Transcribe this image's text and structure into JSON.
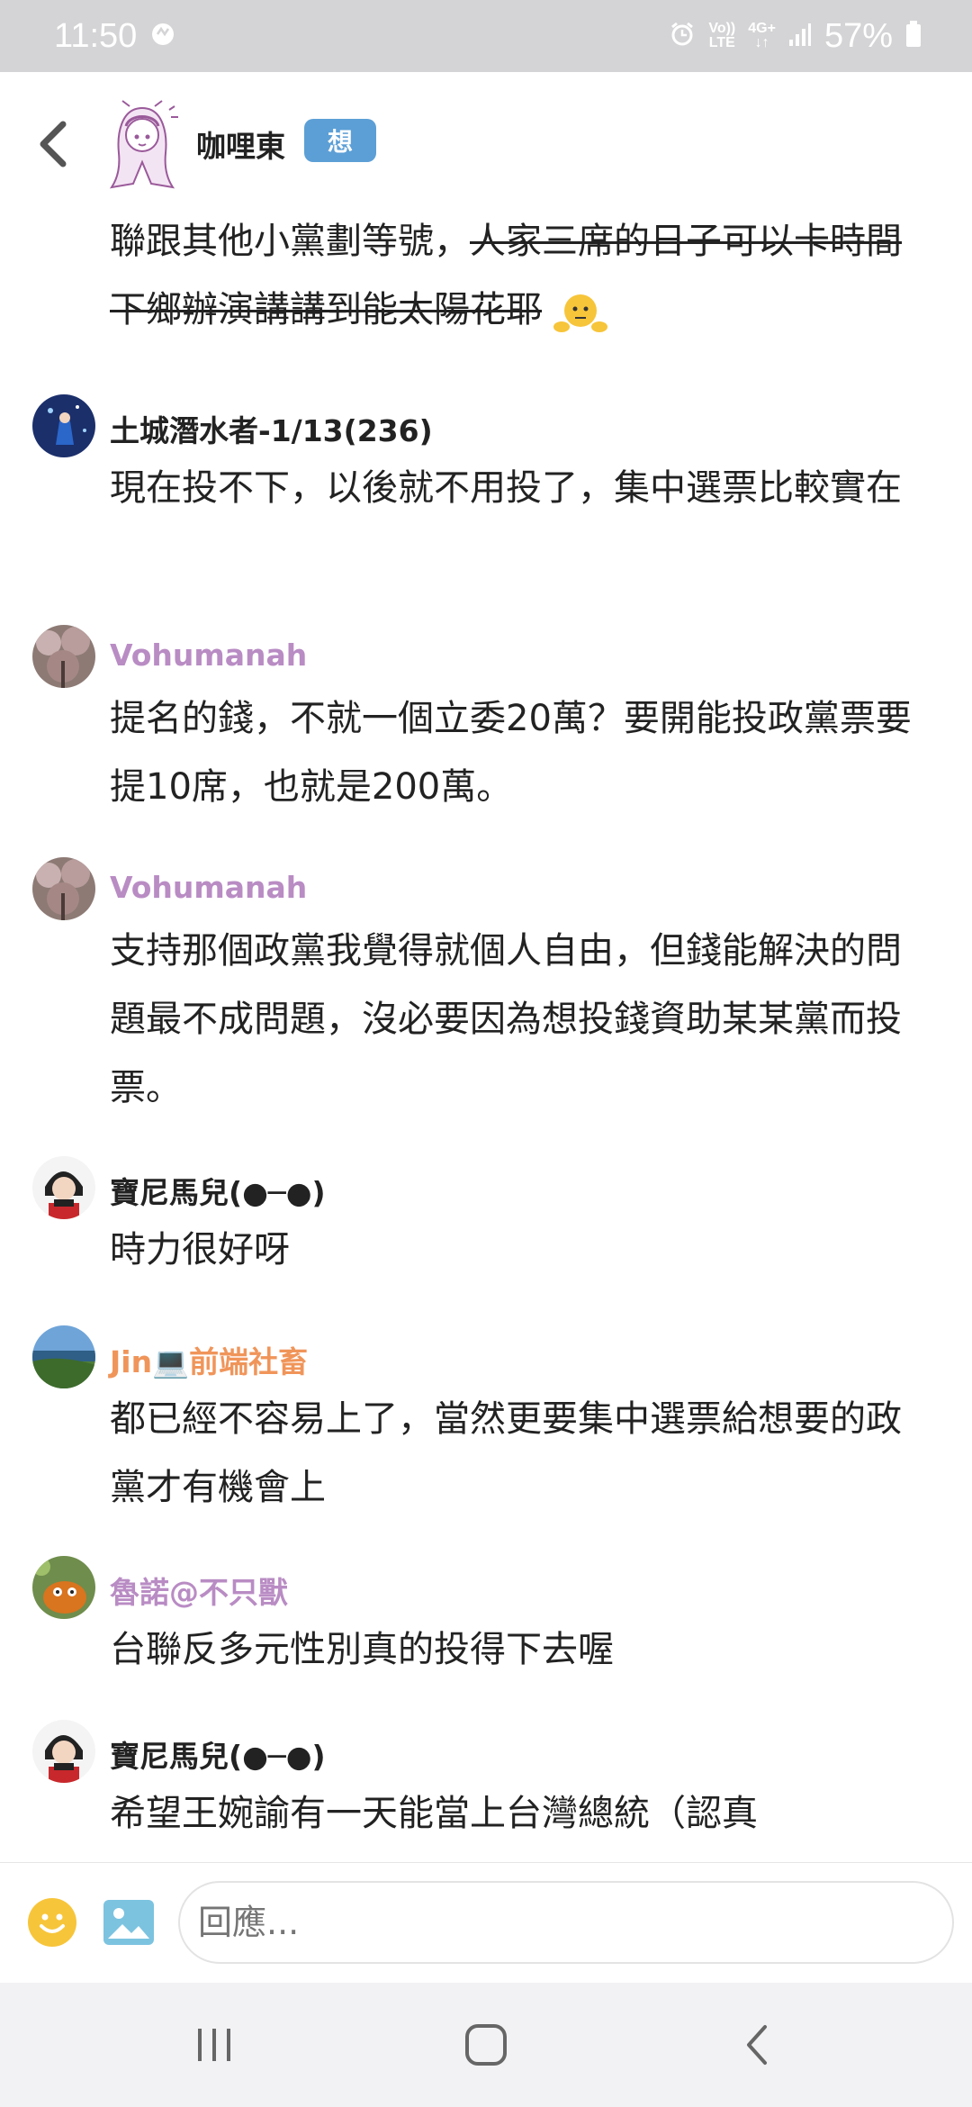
{
  "status_bar": {
    "time": "11:50",
    "volte_top": "Vo))",
    "volte_bottom": "LTE",
    "network": "4G+",
    "battery": "57%"
  },
  "header": {
    "op_name": "咖哩東",
    "op_badge": "想"
  },
  "op_post": {
    "plain": "聯跟其他小黨劃等號，",
    "struck": "人家三席的日子可以卡時間下鄉辦演講講到能太陽花耶"
  },
  "comments": [
    {
      "name": "土城潛水者-1/13(236)",
      "name_color": "#222222",
      "text": "現在投不下，以後就不用投了，集中選票比較實在"
    },
    {
      "name": "Vohumanah",
      "name_color": "#b98cc4",
      "text": "提名的錢，不就一個立委20萬？要開能投政黨票要提10席，也就是200萬。"
    },
    {
      "name": "Vohumanah",
      "name_color": "#b98cc4",
      "text": "支持那個政黨我覺得就個人自由，但錢能解決的問題最不成問題，沒必要因為想投錢資助某某黨而投票。"
    },
    {
      "name": "寶尼馬兒(●─●)",
      "name_color": "#222222",
      "text": "時力很好呀"
    },
    {
      "name": "Jin💻前端社畜",
      "name_color": "#f0955a",
      "text": "都已經不容易上了，當然更要集中選票給想要的政黨才有機會上"
    },
    {
      "name": "魯諾@不只獸",
      "name_color": "#b98cc4",
      "text": "台聯反多元性別真的投得下去喔"
    },
    {
      "name": "寶尼馬兒(●─●)",
      "name_color": "#222222",
      "text": "希望王婉諭有一天能當上台灣總統（認真"
    }
  ],
  "reply": {
    "placeholder": "回應..."
  },
  "icons": {
    "back": "chevron-left-icon",
    "smile": "smile-icon",
    "image": "image-icon",
    "recent": "recent-apps-icon",
    "home": "home-icon",
    "nav_back": "nav-back-icon"
  },
  "colors": {
    "badge": "#5c9fd6",
    "emoji": "#f7c53a",
    "image_icon": "#7cc3e0"
  }
}
